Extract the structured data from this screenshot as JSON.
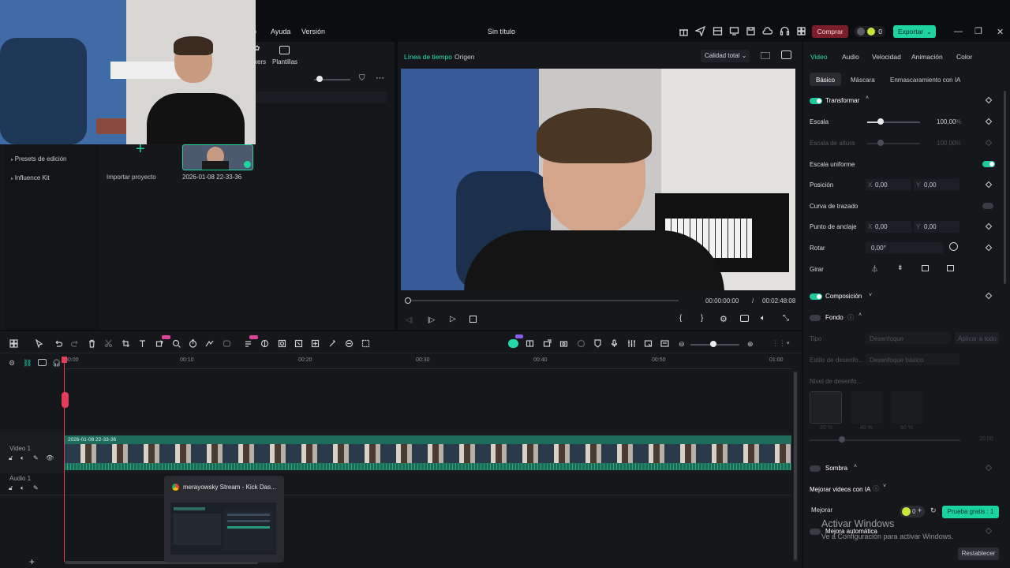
{
  "menu": {
    "ayuda": "Ayuda",
    "version": "Versión",
    "project_title": "Sin título",
    "comprar": "Comprar",
    "credits": "0",
    "exportar": "Exportar"
  },
  "left": {
    "tab_stickers": "kers",
    "tab_plantillas": "Plantillas",
    "presets": "Presets de edición",
    "influence": "Influence Kit",
    "import_label": "Importar proyecto",
    "clip_name": "2026-01-08 22-33-36"
  },
  "preview": {
    "tab_timeline": "Línea de tiempo",
    "tab_origin": "Origen",
    "quality": "Calidad total",
    "current_time": "00:00:00:00",
    "sep": "/",
    "total_time": "00:02:48:08"
  },
  "inspector": {
    "tabs": [
      "Video",
      "Audio",
      "Velocidad",
      "Animación",
      "Color"
    ],
    "subtabs": [
      "Básico",
      "Máscara",
      "Enmascaramiento con IA"
    ],
    "transform": "Transformar",
    "scale": "Escala",
    "scale_value": "100,00",
    "pct": "%",
    "height_scale": "Escala de altura",
    "height_value": "100,00",
    "uniform": "Escala uniforme",
    "position": "Posición",
    "x": "X",
    "y": "Y",
    "pos_x": "0,00",
    "pos_y": "0,00",
    "path_curve": "Curva de trazado",
    "anchor": "Punto de anclaje",
    "anchor_x": "0,00",
    "anchor_y": "0,00",
    "rotate": "Rotar",
    "rotate_value": "0,00°",
    "flip": "Girar",
    "composition": "Composición",
    "background": "Fondo",
    "type": "Tipo",
    "type_value": "Desenfoque",
    "apply_all": "Aplicar a todo",
    "blur_style": "Estilo de desenfo...",
    "blur_style_value": "Desenfoque básico",
    "blur_level": "Nivel de desenfo...",
    "pct20": "20 %",
    "pct40": "40 %",
    "pct60": "60 %",
    "level_value": "20,00",
    "shadow": "Sombra",
    "ai_enhance": "Mejorar videos con IA",
    "improve": "Mejorar",
    "improve_count": "0",
    "trial": "Prueba gratis : 1",
    "auto_improve": "Mejora automática",
    "restore": "Restablecer"
  },
  "windows": {
    "activate": "Activar Windows",
    "activate_sub": "Ve a Configuración para activar Windows."
  },
  "timeline": {
    "ruler": [
      "00:00",
      "00:10",
      "00:20",
      "00:30",
      "00:40",
      "00:50",
      "01:00"
    ],
    "video_track": "Video 1",
    "audio_track": "Audio 1",
    "clip_label": "2026-01-08 22-33-36"
  },
  "taskbar_popup": {
    "title": "merayowsky Stream - Kick Das..."
  }
}
